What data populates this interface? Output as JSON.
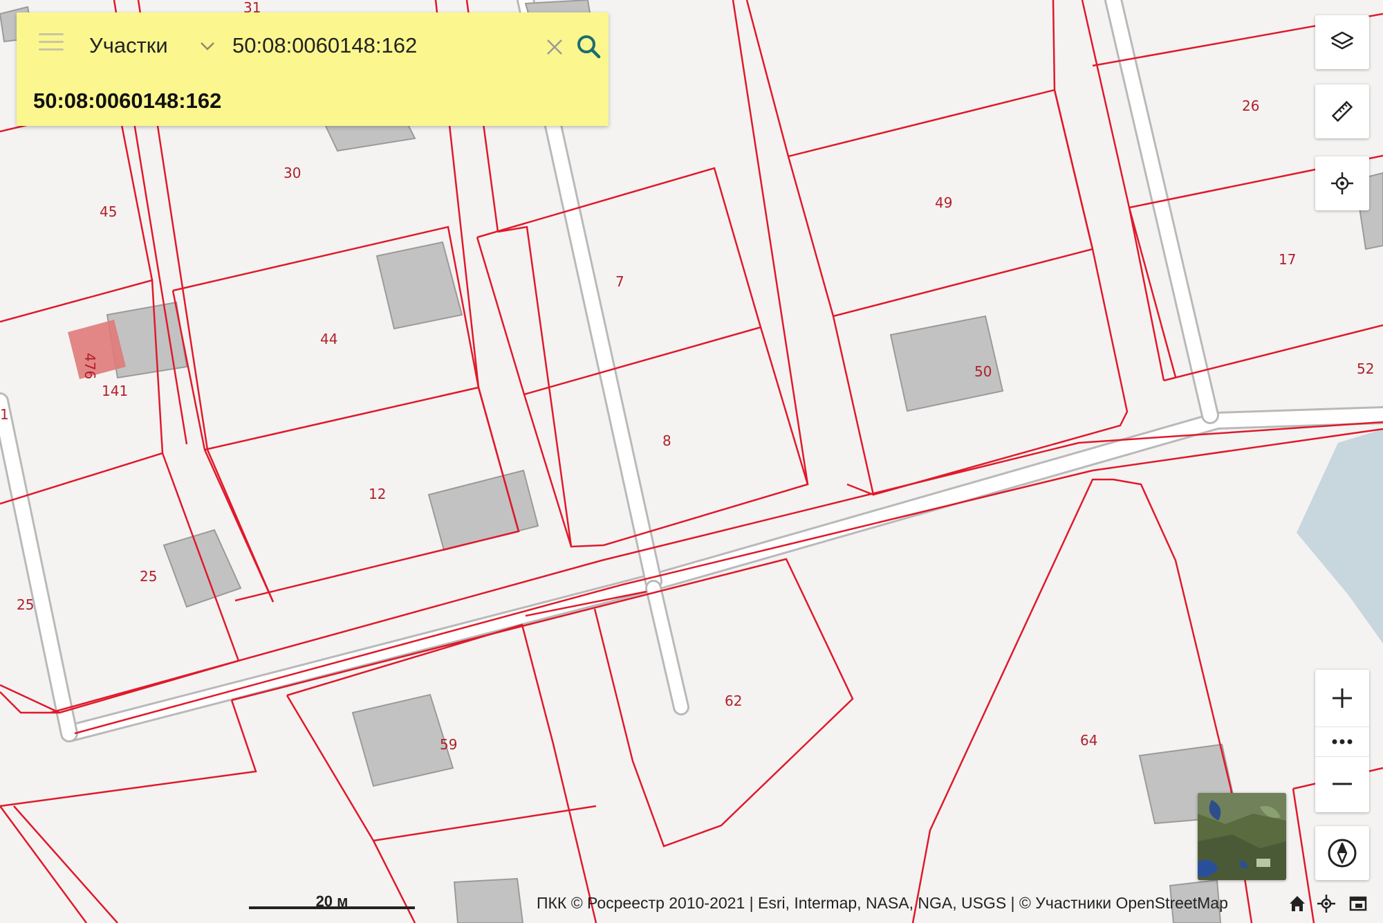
{
  "search": {
    "layer_label": "Участки",
    "query_value": "50:08:0060148:162",
    "result_label": "50:08:0060148:162"
  },
  "map": {
    "plot_labels": [
      "31",
      "30",
      "45",
      "44",
      "141",
      "476",
      "12",
      "25",
      "25",
      "7",
      "8",
      "49",
      "50",
      "26",
      "17",
      "52",
      "62",
      "59",
      "64",
      "1"
    ],
    "scale_label": "20 м",
    "attribution": "ПКК © Росреестр 2010-2021 | Esri, Intermap, NASA, NGA, USGS | © Участники OpenStreetMap"
  },
  "controls": {
    "icons": [
      "layers-icon",
      "ruler-icon",
      "locate-icon",
      "zoom-in-icon",
      "more-icon",
      "zoom-out-icon",
      "compass-icon",
      "home-icon",
      "crosshair-icon",
      "window-icon",
      "menu-icon",
      "chevron-down-icon",
      "clear-icon",
      "search-icon"
    ]
  },
  "colors": {
    "parcel_border": "#e0192a",
    "building": "#c2c2c2",
    "search_bg": "#fbf68e",
    "water": "#c8d6de",
    "highlight_plot": "#e07a7a",
    "search_icon": "#1d6d6d"
  }
}
